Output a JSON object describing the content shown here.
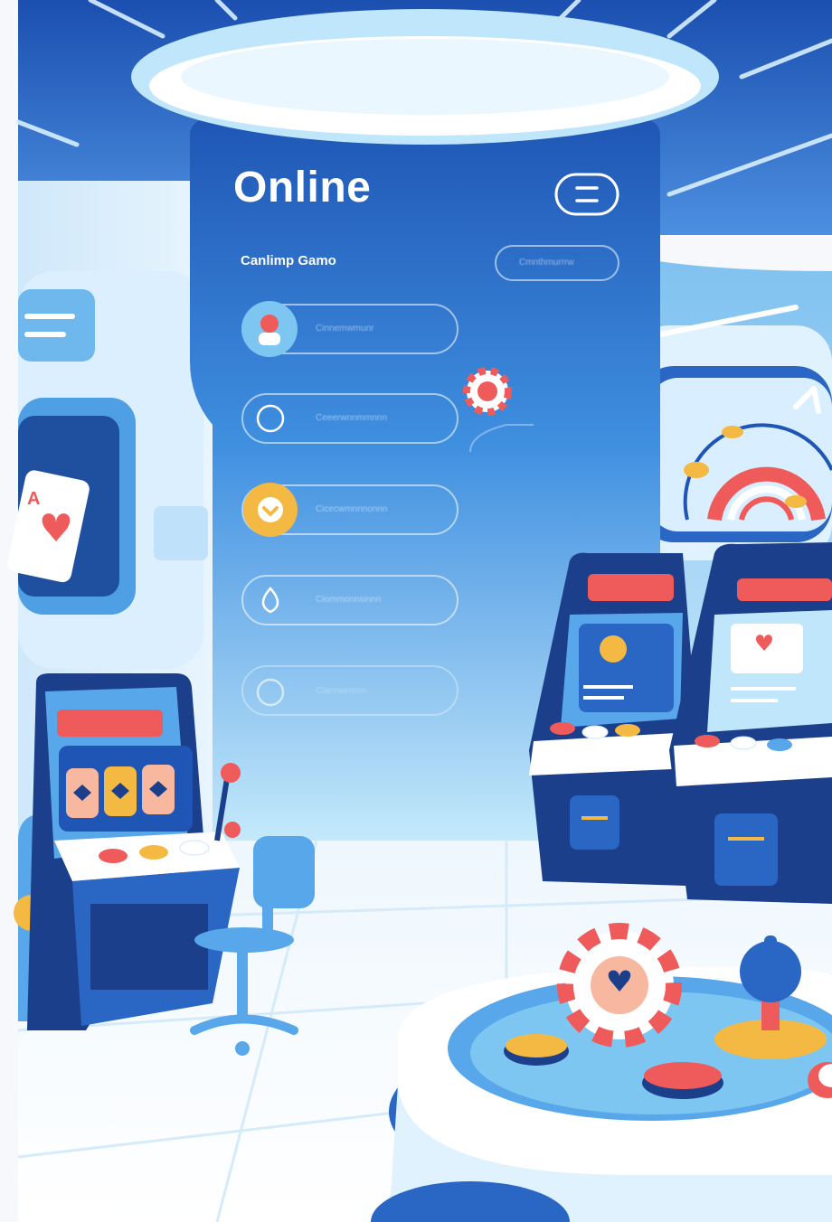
{
  "screen": {
    "title": "Online",
    "subtitle": "Canlimp Gamo",
    "top_right_pill": "Cmnthmurrrw",
    "menu_items": [
      {
        "icon": "user-avatar-icon",
        "label": "Cinnemwmunr"
      },
      {
        "icon": "circle-icon",
        "label": "Ceeerwnnmmnnn"
      },
      {
        "icon": "heart-badge-icon",
        "label": "Cicecwmnnnonnn"
      },
      {
        "icon": "drop-icon",
        "label": "Ciommonnsinnn"
      },
      {
        "icon": "circle-icon",
        "label": "Ciannwmmn"
      }
    ]
  },
  "colors": {
    "panel_top": "#1f56b5",
    "panel_bottom": "#bfe6fb",
    "accent_red": "#ef5b5b",
    "accent_yellow": "#f4b942",
    "navy": "#1c3f8c",
    "sky": "#58a7ea"
  }
}
